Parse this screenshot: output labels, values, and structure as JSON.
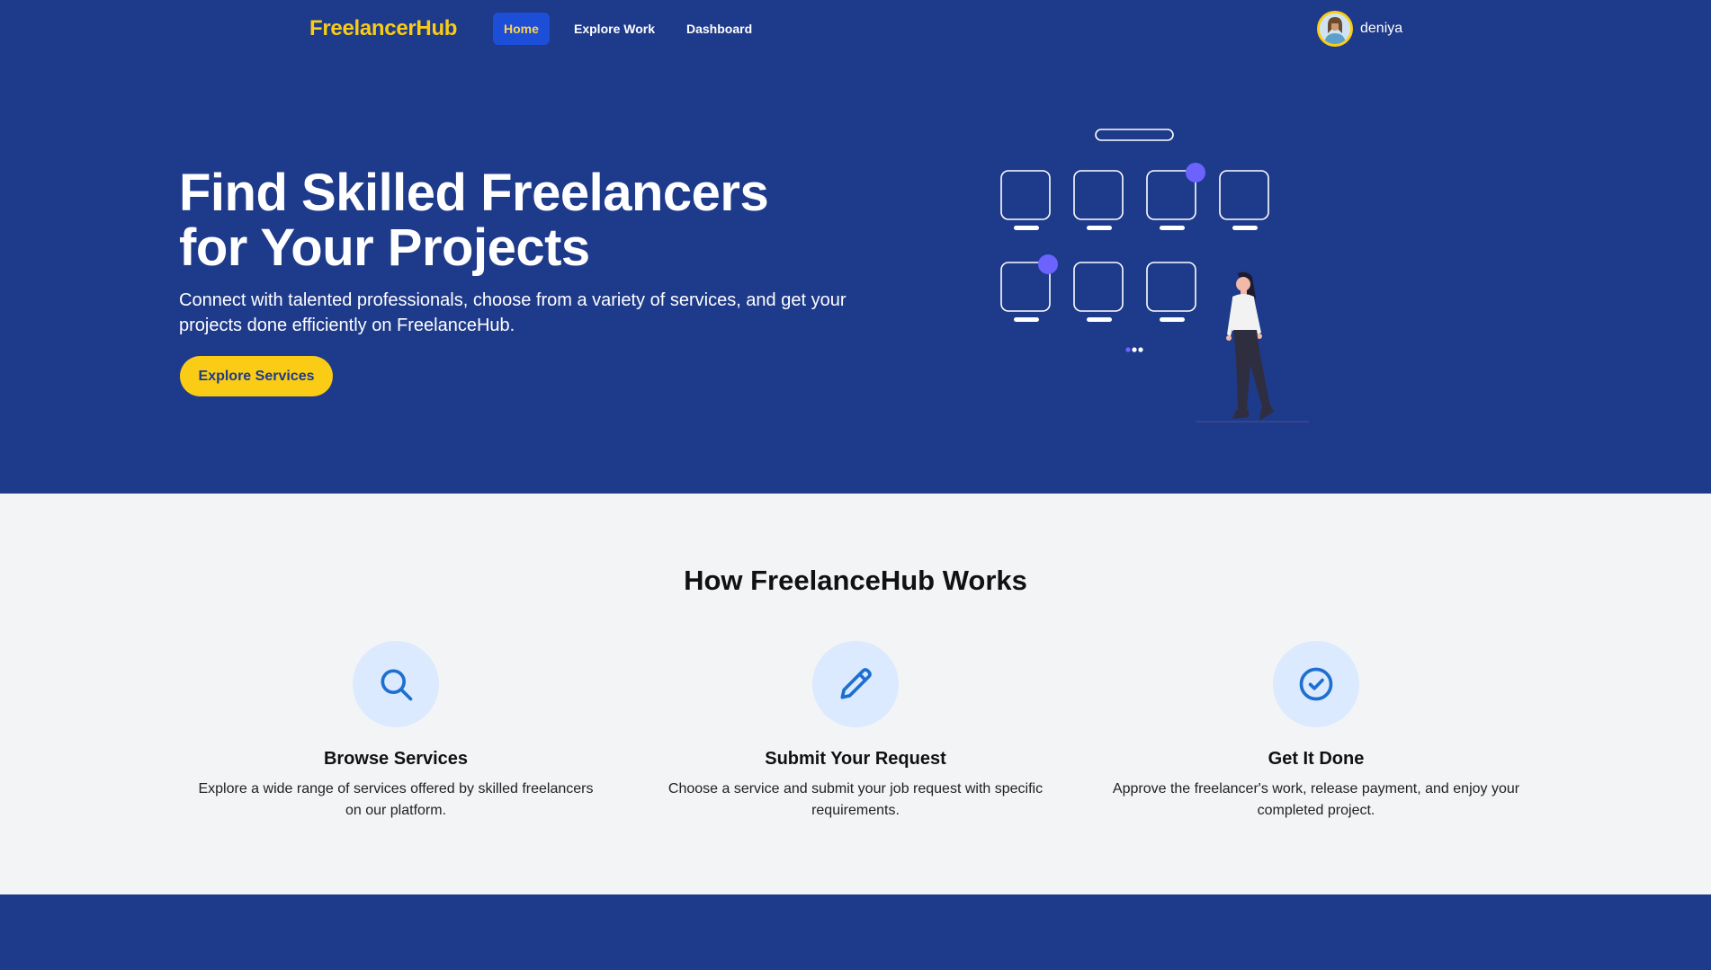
{
  "nav": {
    "brand": "FreelancerHub",
    "links": [
      {
        "label": "Home",
        "active": true
      },
      {
        "label": "Explore Work",
        "active": false
      },
      {
        "label": "Dashboard",
        "active": false
      }
    ],
    "user": {
      "name": "deniya",
      "avatar_icon": "user-avatar-icon"
    }
  },
  "hero": {
    "title_line1": "Find Skilled Freelancers",
    "title_line2": "for Your Projects",
    "subtitle": "Connect with talented professionals, choose from a variety of services, and get your projects done efficiently on FreelanceHub.",
    "cta_label": "Explore Services",
    "illustration_icon": "woman-with-screens-illustration"
  },
  "how": {
    "title": "How FreelanceHub Works",
    "steps": [
      {
        "icon": "search-icon",
        "title": "Browse Services",
        "text": "Explore a wide range of services offered by skilled freelancers on our platform."
      },
      {
        "icon": "pencil-icon",
        "title": "Submit Your Request",
        "text": "Choose a service and submit your job request with specific requirements."
      },
      {
        "icon": "check-circle-icon",
        "title": "Get It Done",
        "text": "Approve the freelancer's work, release payment, and enjoy your completed project."
      }
    ]
  },
  "colors": {
    "primary": "#1e3a8a",
    "accent": "#facc15",
    "active_nav_bg": "#1d4ed8",
    "icon_blue": "#1d6fd0",
    "icon_circle": "#dbeafe",
    "illustration_dot": "#6c63ff"
  }
}
